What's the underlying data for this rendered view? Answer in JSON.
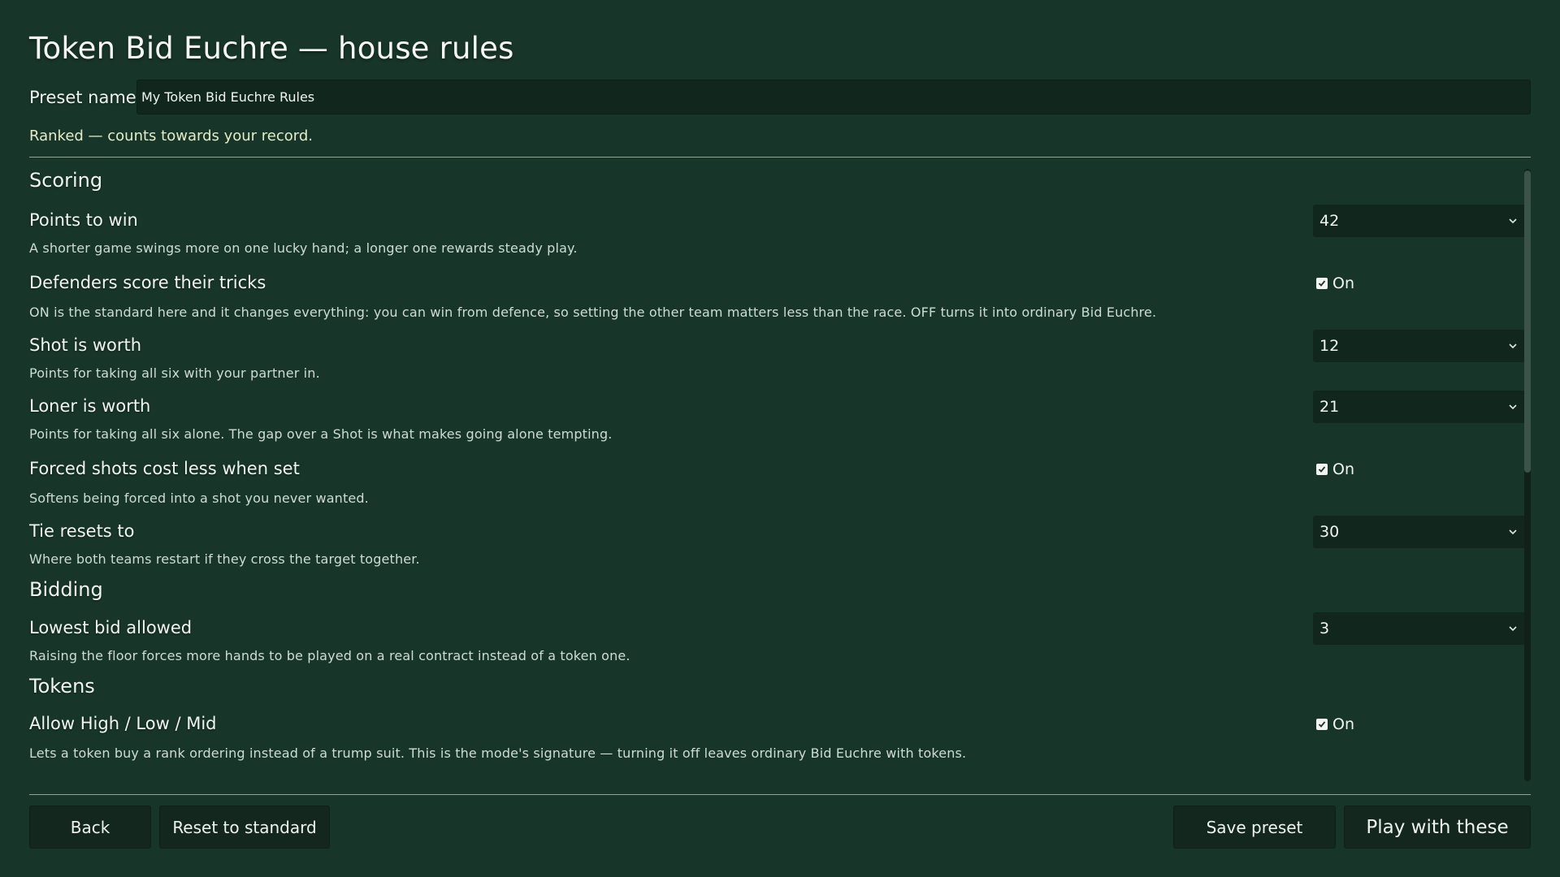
{
  "page": {
    "title": "Token Bid Euchre — house rules"
  },
  "preset": {
    "label": "Preset name",
    "value": "My Token Bid Euchre Rules"
  },
  "status": {
    "ranked_text": "Ranked — counts towards your record."
  },
  "sections": {
    "scoring": {
      "heading": "Scoring",
      "points_to_win": {
        "label": "Points to win",
        "description": "A shorter game swings more on one lucky hand; a longer one rewards steady play.",
        "value": "42"
      },
      "defenders_score": {
        "label": "Defenders score their tricks",
        "description": "ON is the standard here and it changes everything: you can win from defence, so setting the other team matters less than the race. OFF turns it into ordinary Bid Euchre.",
        "checked": true,
        "state_label": "On"
      },
      "shot_worth": {
        "label": "Shot is worth",
        "description": "Points for taking all six with your partner in.",
        "value": "12"
      },
      "loner_worth": {
        "label": "Loner is worth",
        "description": "Points for taking all six alone. The gap over a Shot is what makes going alone tempting.",
        "value": "21"
      },
      "forced_shots": {
        "label": "Forced shots cost less when set",
        "description": "Softens being forced into a shot you never wanted.",
        "checked": true,
        "state_label": "On"
      },
      "tie_resets": {
        "label": "Tie resets to",
        "description": "Where both teams restart if they cross the target together.",
        "value": "30"
      }
    },
    "bidding": {
      "heading": "Bidding",
      "lowest_bid": {
        "label": "Lowest bid allowed",
        "description": "Raising the floor forces more hands to be played on a real contract instead of a token one.",
        "value": "3"
      }
    },
    "tokens": {
      "heading": "Tokens",
      "allow_hlm": {
        "label": "Allow High / Low / Mid",
        "description": "Lets a token buy a rank ordering instead of a trump suit. This is the mode's signature — turning it off leaves ordinary Bid Euchre with tokens.",
        "checked": true,
        "state_label": "On"
      }
    }
  },
  "footer": {
    "back_label": "Back",
    "reset_label": "Reset to standard",
    "save_label": "Save preset",
    "play_label": "Play with these"
  },
  "icons": {
    "select_arrow": "chevron-down-icon",
    "checkbox_mark": "check-icon"
  },
  "colors": {
    "background": "#173528",
    "control": "#11261d",
    "ranked_text": "#e3ecc7"
  }
}
